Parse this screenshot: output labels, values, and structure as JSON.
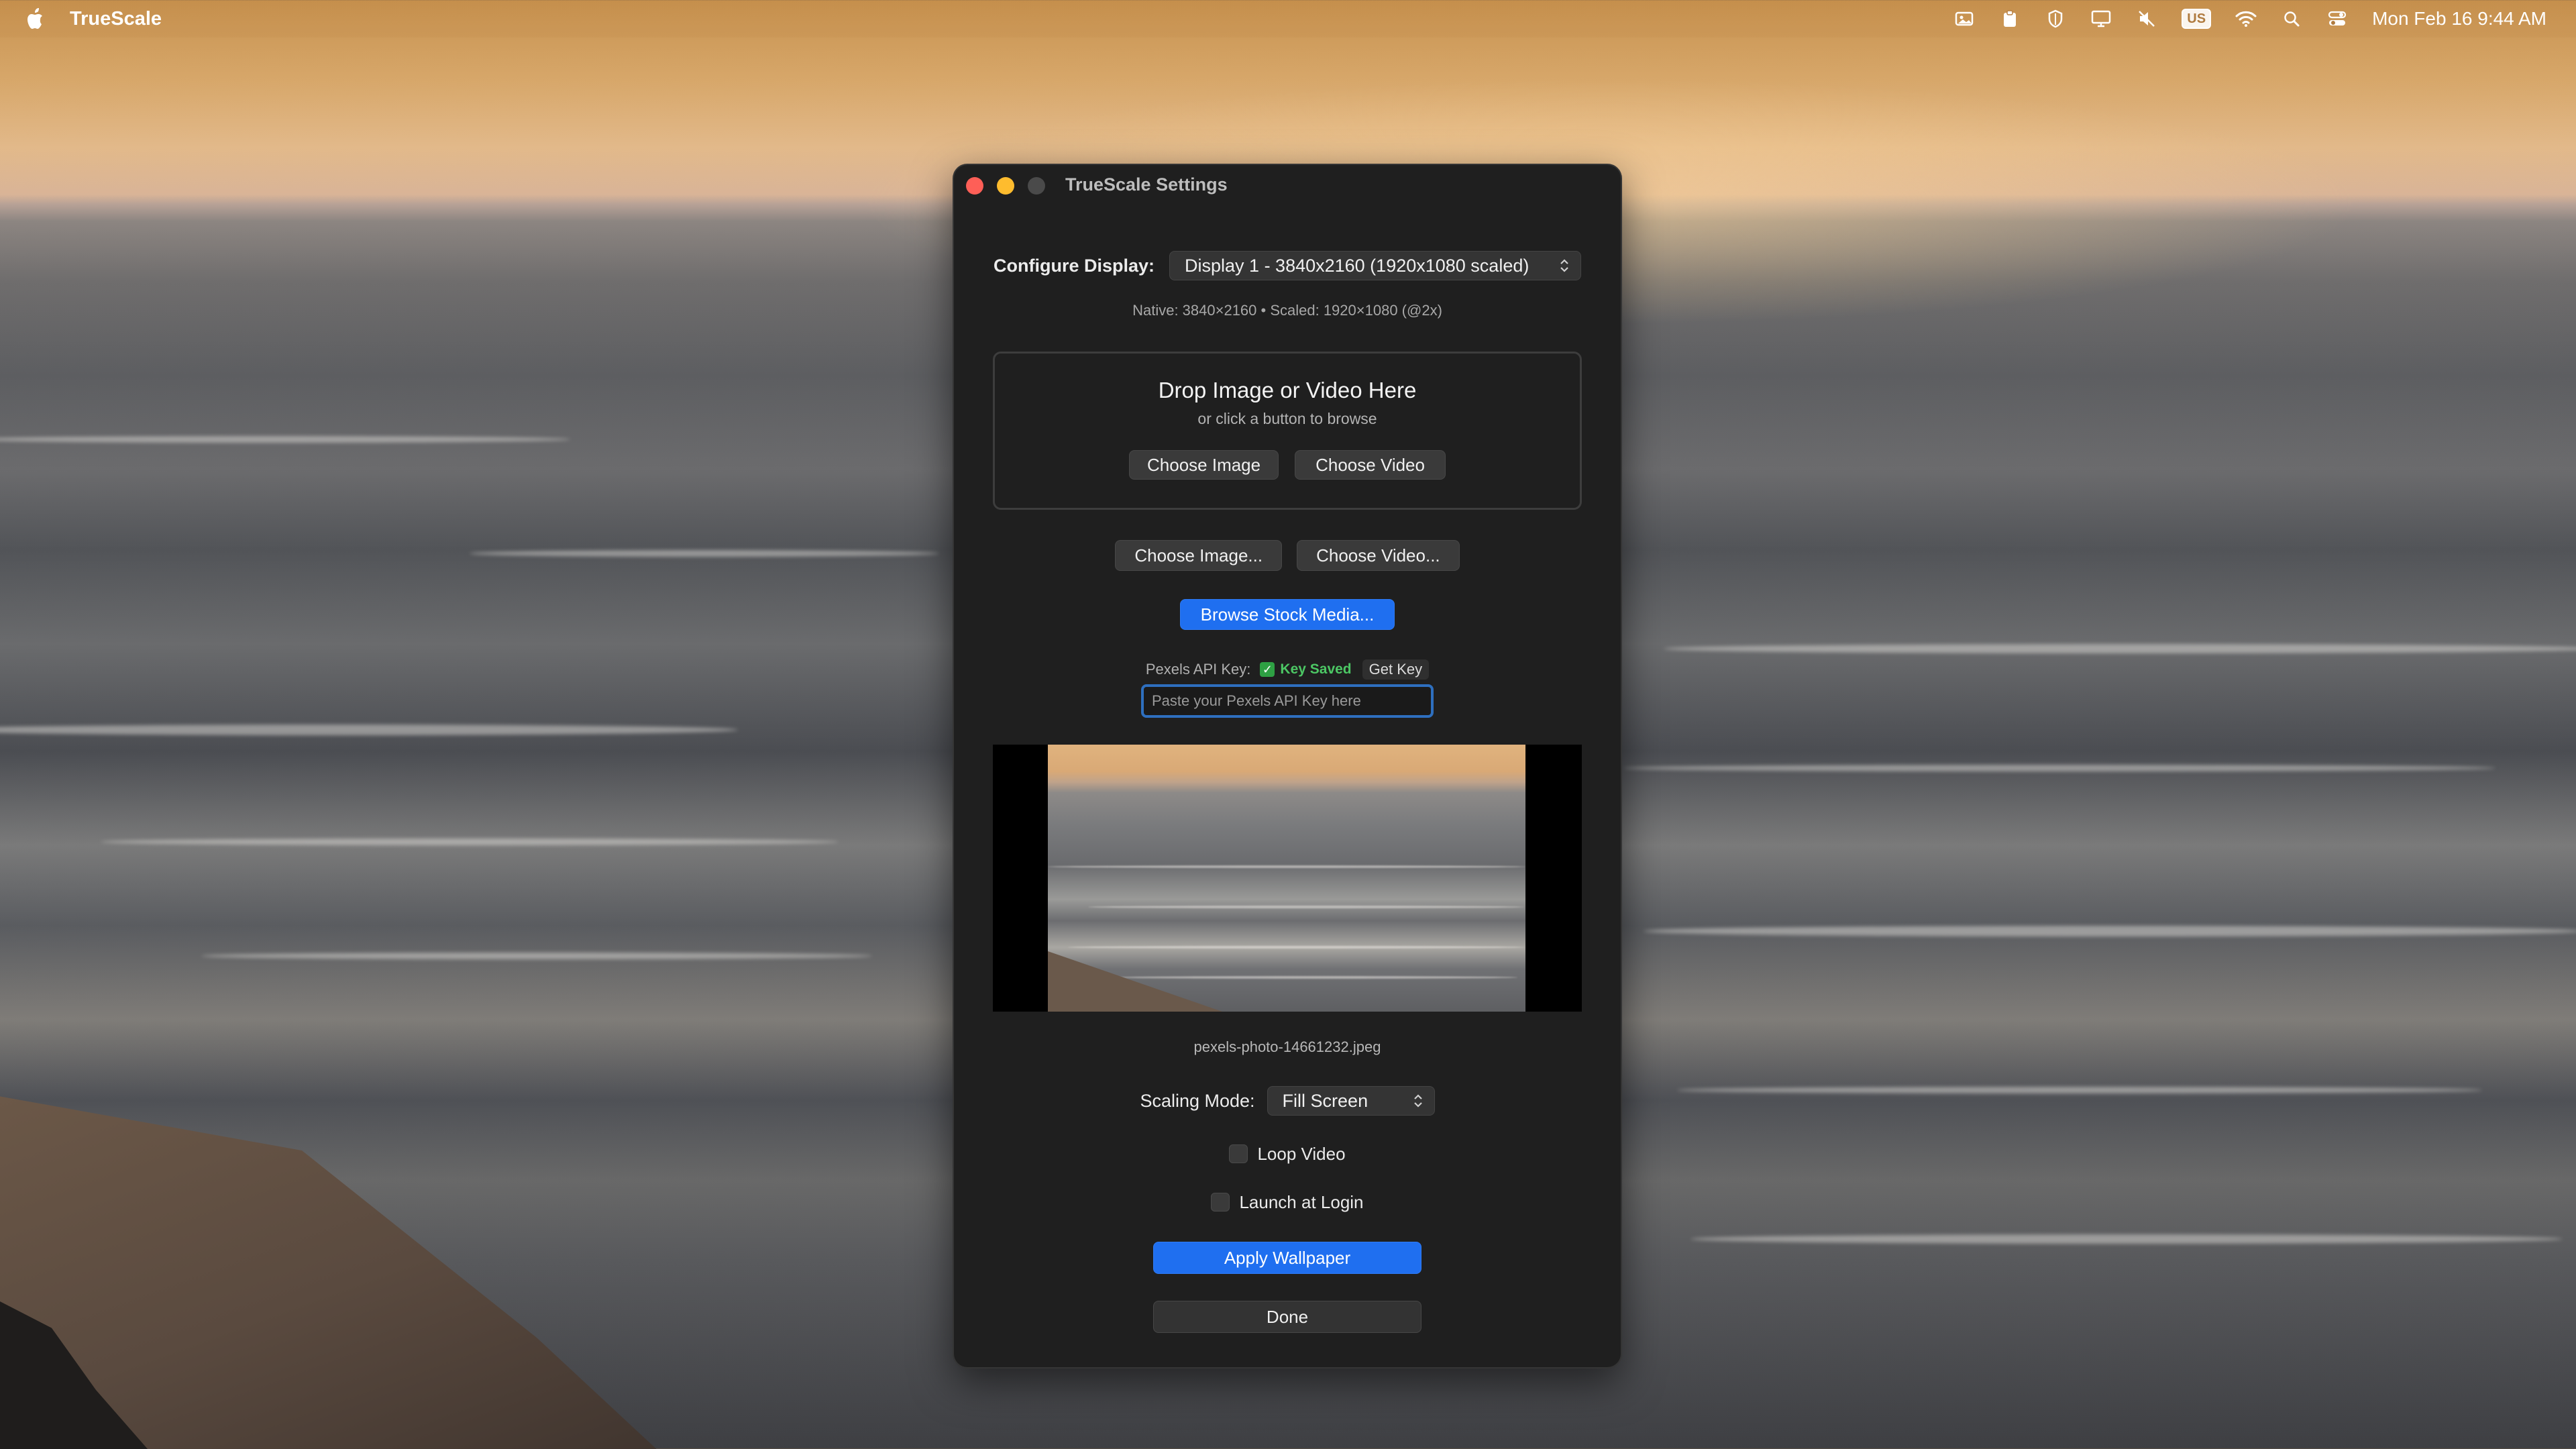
{
  "menubar": {
    "app_name": "TrueScale",
    "clock": "Mon Feb 16  9:44 AM",
    "input_badge": "US",
    "icons": [
      "photo-icon",
      "clipboard-icon",
      "shield-icon",
      "display-icon",
      "mute-icon",
      "keyboard-input-icon",
      "wifi-icon",
      "search-icon",
      "control-center-icon"
    ]
  },
  "window": {
    "title": "TrueScale Settings",
    "configure_label": "Configure Display:",
    "display_selected": "Display 1 - 3840x2160 (1920x1080 scaled)",
    "resolution_note": "Native: 3840×2160 • Scaled: 1920×1080 (@2x)",
    "dropzone": {
      "title": "Drop Image or Video Here",
      "subtitle": "or click a button to browse",
      "choose_image": "Choose Image",
      "choose_video": "Choose Video"
    },
    "choose_image_ellipsis": "Choose Image...",
    "choose_video_ellipsis": "Choose Video...",
    "browse_stock": "Browse Stock Media...",
    "api": {
      "label": "Pexels API Key:",
      "status": "Key Saved",
      "get_key": "Get Key",
      "placeholder": "Paste your Pexels API Key here",
      "value": ""
    },
    "filename": "pexels-photo-14661232.jpeg",
    "scaling_label": "Scaling Mode:",
    "scaling_selected": "Fill Screen",
    "loop_video": "Loop Video",
    "launch_at_login": "Launch at Login",
    "apply": "Apply Wallpaper",
    "done": "Done"
  },
  "colors": {
    "accent": "#1f6ff0",
    "window_bg": "#1f1f1f",
    "key_saved": "#4cc764",
    "close": "#fe5f57",
    "minimize": "#febc2e"
  }
}
